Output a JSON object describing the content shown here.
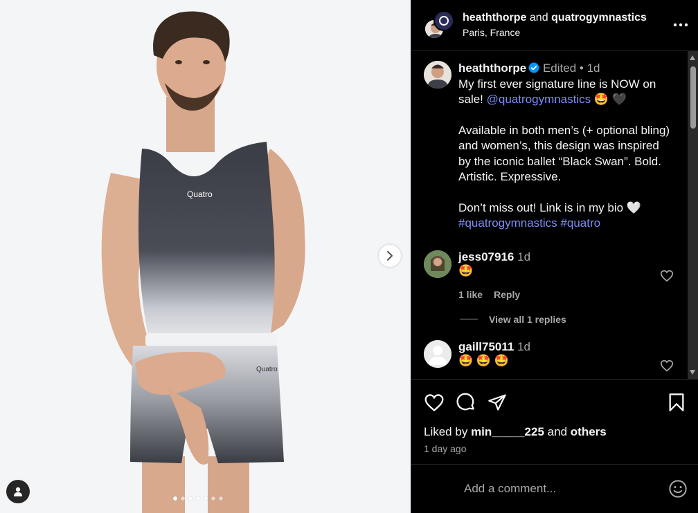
{
  "post": {
    "carousel": {
      "total_slides": 7,
      "active_index": 0
    },
    "header": {
      "author": "heaththorpe",
      "connector": "and",
      "collaborator": "quatrogymnastics",
      "location": "Paris, France"
    },
    "caption": {
      "username": "heaththorpe",
      "edited_label": "Edited",
      "separator": "•",
      "age": "1d",
      "line1": "My first ever signature line is NOW on sale!",
      "mention": "@quatrogymnastics",
      "line1_emoji": "🤩 🖤",
      "para2": "Available in both men’s (+ optional bling) and women’s, this design was inspired by the iconic ballet “Black Swan”. Bold. Artistic. Expressive.",
      "para3": "Don’t miss out! Link is in my bio",
      "para3_emoji": "🤍",
      "hashtag1": "#quatrogymnastics",
      "hashtag2": "#quatro"
    },
    "photo_text": {
      "shirt_logo": "Quatro",
      "shorts_logo": "Quatro"
    },
    "comments": [
      {
        "username": "jess07916",
        "age": "1d",
        "text": "🤩",
        "likes_label": "1 like",
        "reply_label": "Reply"
      },
      {
        "username": "gaill75011",
        "age": "1d",
        "text": "🤩 🤩 🤩"
      }
    ],
    "view_replies_label": "View all 1 replies",
    "liked_by": {
      "prefix": "Liked by",
      "user": "min_____225",
      "connector": "and",
      "others": "others"
    },
    "timestamp": "1 day ago",
    "add_comment_placeholder": "Add a comment..."
  },
  "colors": {
    "panel_bg": "#000000",
    "text": "#f5f5f5",
    "muted": "#a8a8a8",
    "link": "#7f8df7",
    "verified": "#0095f6",
    "photo_bg": "#f4f5f7"
  },
  "icons": [
    "more-icon",
    "verified-icon",
    "heart-icon",
    "comment-icon",
    "share-icon",
    "bookmark-icon",
    "emoji-icon",
    "chevron-right-icon",
    "user-tag-icon"
  ]
}
